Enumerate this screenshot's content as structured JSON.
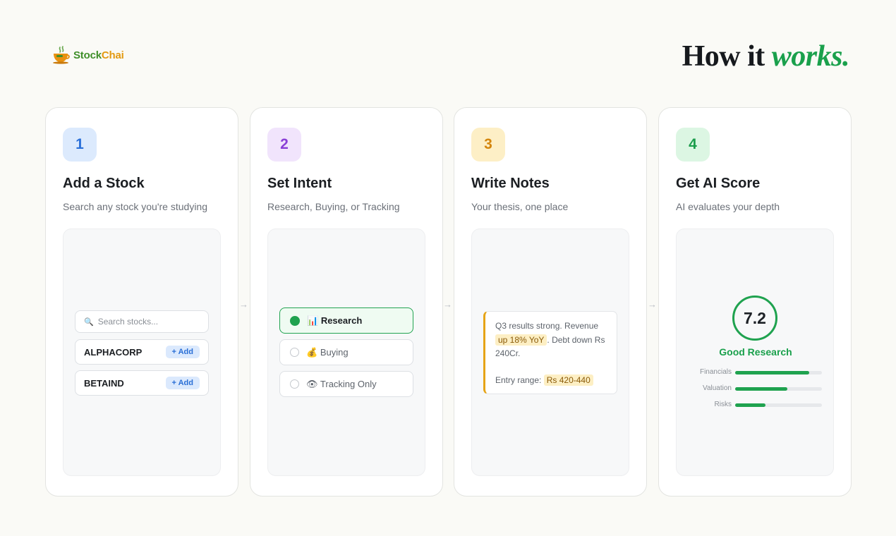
{
  "brand": {
    "name_part1": "Stock",
    "name_part2": "Chai"
  },
  "headline": {
    "text": "How it",
    "accent": "works."
  },
  "arrow_glyph": "→",
  "steps": [
    {
      "number": "1",
      "title": "Add a Stock",
      "subtitle": "Search any stock you're studying",
      "badge_bg": "#dceafd",
      "badge_color": "#2b70d9",
      "search": {
        "icon": "🔍",
        "placeholder": "Search stocks..."
      },
      "stocks": [
        {
          "name": "ALPHACORP",
          "action": "+ Add"
        },
        {
          "name": "BETAIND",
          "action": "+ Add"
        }
      ]
    },
    {
      "number": "2",
      "title": "Set Intent",
      "subtitle": "Research, Buying, or Tracking",
      "badge_bg": "#f1e4fc",
      "badge_color": "#8a3fd6",
      "options": [
        {
          "icon": "📊",
          "label": "Research",
          "selected": true
        },
        {
          "icon": "💰",
          "label": "Buying",
          "selected": false
        },
        {
          "icon": "👁",
          "label": "Tracking Only",
          "selected": false
        }
      ]
    },
    {
      "number": "3",
      "title": "Write Notes",
      "subtitle": "Your thesis, one place",
      "badge_bg": "#fdefc6",
      "badge_color": "#d4860d",
      "note": {
        "line1": "Q3 results strong. Revenue",
        "highlight1": "up 18% YoY",
        "line2": ". Debt down Rs 240Cr.",
        "entry_label": "Entry range:",
        "highlight2": "Rs 420-440"
      }
    },
    {
      "number": "4",
      "title": "Get AI Score",
      "subtitle": "AI evaluates your depth",
      "badge_bg": "#dcf6e3",
      "badge_color": "#1c9d4c",
      "score": "7.2",
      "score_label": "Good Research",
      "metrics": [
        {
          "label": "Financials",
          "value": 0.85
        },
        {
          "label": "Valuation",
          "value": 0.6
        },
        {
          "label": "Risks",
          "value": 0.35
        }
      ]
    }
  ]
}
